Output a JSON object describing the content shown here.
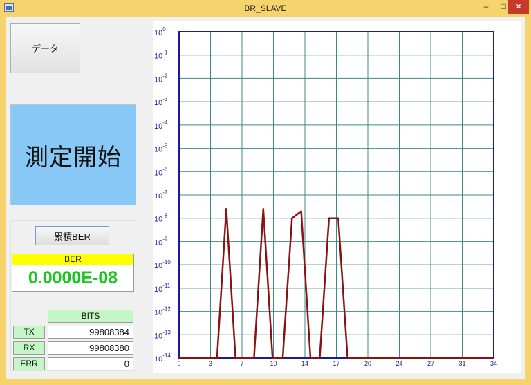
{
  "window": {
    "title": "BR_SLAVE",
    "minimize_glyph": "–",
    "maximize_glyph": "□",
    "close_glyph": "×"
  },
  "buttons": {
    "data_label": "データ",
    "start_label": "測定開始",
    "cumulative_label": "累積BER"
  },
  "ber": {
    "header": "BER",
    "value": "0.0000E-08"
  },
  "bits": {
    "header": "BITS",
    "rows": [
      {
        "label": "TX",
        "value": "99808384"
      },
      {
        "label": "RX",
        "value": "99808380"
      },
      {
        "label": "ERR",
        "value": "0"
      }
    ]
  },
  "colors": {
    "title_bar": "#f6d36c",
    "start_panel": "#87c8f7",
    "ber_value": "#19c61e",
    "ber_header": "#ffff00",
    "bits_header": "#c5f6c5",
    "series": "#8b1212",
    "axis": "#1a1a9c",
    "grid": "#3c8a88"
  },
  "chart_data": {
    "type": "line",
    "y_scale": "log",
    "ylim": [
      1e-14,
      1
    ],
    "xlim": [
      0,
      34
    ],
    "grid": true,
    "x_ticks": [
      "0",
      "3",
      "7",
      "10",
      "14",
      "17",
      "20",
      "24",
      "27",
      "31",
      "34"
    ],
    "y_ticks": [
      {
        "base": "10",
        "exp": "0"
      },
      {
        "base": "10",
        "exp": "-1"
      },
      {
        "base": "10",
        "exp": "-2"
      },
      {
        "base": "10",
        "exp": "-3"
      },
      {
        "base": "10",
        "exp": "-4"
      },
      {
        "base": "10",
        "exp": "-5"
      },
      {
        "base": "10",
        "exp": "-6"
      },
      {
        "base": "10",
        "exp": "-7"
      },
      {
        "base": "10",
        "exp": "-8"
      },
      {
        "base": "10",
        "exp": "-9"
      },
      {
        "base": "10",
        "exp": "-10"
      },
      {
        "base": "10",
        "exp": "-11"
      },
      {
        "base": "10",
        "exp": "-12"
      },
      {
        "base": "10",
        "exp": "-13"
      },
      {
        "base": "10",
        "exp": "-14"
      }
    ],
    "series": [
      {
        "points": [
          [
            0,
            -14
          ],
          [
            4.1,
            -14
          ],
          [
            5.1,
            -7.6
          ],
          [
            6.1,
            -14
          ],
          [
            8.1,
            -14
          ],
          [
            9.1,
            -7.6
          ],
          [
            10.1,
            -14
          ],
          [
            11.2,
            -14
          ],
          [
            12.2,
            -8.0
          ],
          [
            13.2,
            -7.7
          ],
          [
            14.2,
            -14
          ],
          [
            15.2,
            -14
          ],
          [
            16.2,
            -8.0
          ],
          [
            17.2,
            -8.0
          ],
          [
            18.2,
            -14
          ],
          [
            34,
            -14
          ]
        ]
      }
    ]
  }
}
